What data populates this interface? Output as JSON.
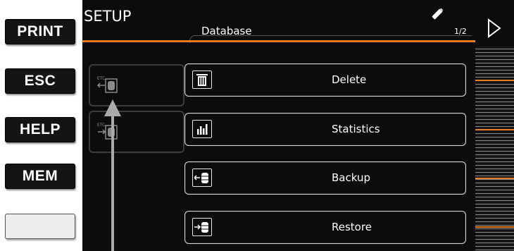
{
  "hw_keys": [
    "PRINT",
    "ESC",
    "HELP",
    "MEM",
    ""
  ],
  "screen": {
    "title": "SETUP",
    "subtitle": "Database",
    "page": "1/2"
  },
  "side_buttons": [
    {
      "icon": "etc-import-icon",
      "label": "ETC"
    },
    {
      "icon": "etc-export-icon",
      "label": "ETC"
    }
  ],
  "menu": [
    {
      "label": "Delete",
      "icon": "trash-icon"
    },
    {
      "label": "Statistics",
      "icon": "bar-chart-icon"
    },
    {
      "label": "Backup",
      "icon": "database-backup-icon"
    },
    {
      "label": "Restore",
      "icon": "database-restore-icon"
    }
  ],
  "colors": {
    "accent": "#e67e22",
    "screen_bg": "#0c0c0c",
    "key_bg": "#141414"
  }
}
